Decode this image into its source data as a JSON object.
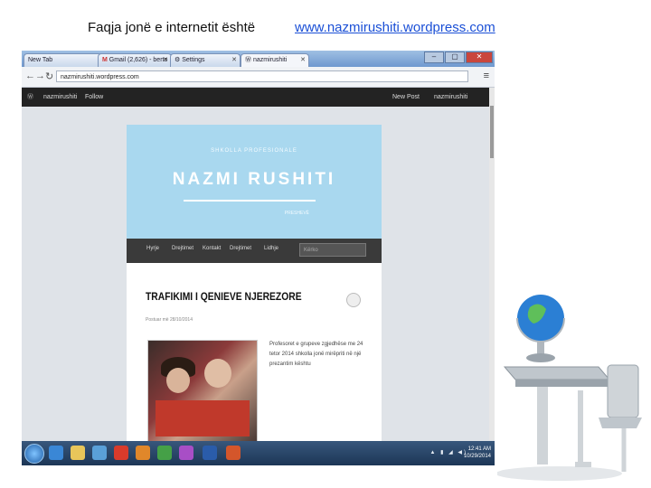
{
  "slide": {
    "title": "Faqja jonë e internetit është",
    "url": "www.nazmirushiti.wordpress.com"
  },
  "browser": {
    "tabs": [
      {
        "label": "New Tab"
      },
      {
        "label": "Gmail (2,626) - berto"
      },
      {
        "label": "Settings"
      },
      {
        "label": "nazmirushiti"
      }
    ],
    "window_buttons": [
      "–",
      "▢",
      "✕"
    ],
    "address": "nazmirushiti.wordpress.com",
    "nav_icons": [
      "back-arrow-icon",
      "forward-arrow-icon",
      "reload-icon",
      "menu-icon"
    ]
  },
  "wp_admin_bar": {
    "site": "nazmirushiti",
    "reader": "Follow",
    "new_post": "New Post",
    "user": "nazmirushiti"
  },
  "site": {
    "subtitle": "SHKOLLA PROFESIONALE",
    "name": "NAZMI RUSHITI",
    "small": "PRESHEVË",
    "nav": [
      "Hyrje",
      "Drejtimet",
      "Kontakt",
      "Drejtimet",
      "Lidhje"
    ],
    "search_placeholder": "Kërko",
    "post": {
      "title": "TRAFIKIMI I QENIEVE NJEREZORE",
      "meta": "Postuar më 28/10/2014",
      "text": "Profesoret e grupeve zgjedhëse me 24 tetor 2014 shkolla jonë mirëpriti në një prezantim kështu"
    }
  },
  "taskbar": {
    "tray": "▲ ▮ ◢ ◀)",
    "time": "12:41 AM",
    "date": "10/29/2014"
  },
  "colors": {
    "hero": "#a9d8ef",
    "url_link": "#1a4fd6",
    "taskbar": "#1d3656"
  }
}
